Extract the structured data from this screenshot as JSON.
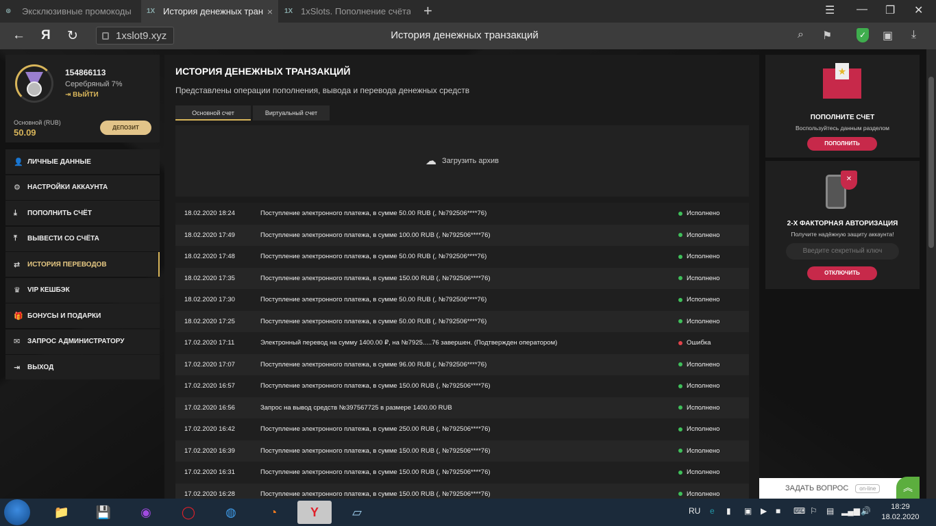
{
  "browser": {
    "tabs": [
      {
        "label": "Эксклюзивные промокоды",
        "icon": "⊛"
      },
      {
        "label": "История денежных тран",
        "icon": "1X",
        "close": "×"
      },
      {
        "label": "1xSlots. Пополнение счёта",
        "icon": "1X"
      }
    ],
    "new_tab": "+",
    "yandex_logo": "Я",
    "url": "1xslot9.xyz",
    "page_title": "История денежных транзакций"
  },
  "profile": {
    "id": "154866113",
    "level": "Серебряный 7%",
    "logout": "ВЫЙТИ",
    "balance_label": "Основной (RUB)",
    "balance": "50.09",
    "deposit": "ДЕПОЗИТ"
  },
  "menu": [
    {
      "label": "ЛИЧНЫЕ ДАННЫЕ",
      "icon": "person-add-icon",
      "glyph": "👤"
    },
    {
      "label": "НАСТРОЙКИ АККАУНТА",
      "icon": "settings-icon",
      "glyph": "⚙"
    },
    {
      "label": "ПОПОЛНИТЬ СЧЁТ",
      "icon": "download-icon",
      "glyph": "⤓"
    },
    {
      "label": "ВЫВЕСТИ СО СЧЁТА",
      "icon": "upload-icon",
      "glyph": "⤒"
    },
    {
      "label": "ИСТОРИЯ ПЕРЕВОДОВ",
      "icon": "transfer-icon",
      "glyph": "⇄",
      "active": true
    },
    {
      "label": "VIP КЕШБЭК",
      "icon": "crown-icon",
      "glyph": "♛"
    },
    {
      "label": "БОНУСЫ И ПОДАРКИ",
      "icon": "gift-icon",
      "glyph": "🎁"
    },
    {
      "label": "ЗАПРОС АДМИНИСТРАТОРУ",
      "icon": "envelope-icon",
      "glyph": "✉"
    },
    {
      "label": "ВЫХОД",
      "icon": "exit-icon",
      "glyph": "⇥"
    }
  ],
  "main": {
    "title": "ИСТОРИЯ ДЕНЕЖНЫХ ТРАНЗАКЦИЙ",
    "description": "Представлены операции пополнения, вывода и перевода денежных средств",
    "tabs": [
      {
        "label": "Основной счет",
        "active": true
      },
      {
        "label": "Виртуальный счет"
      }
    ],
    "archive_label": "Загрузить архив",
    "transactions": [
      {
        "date": "18.02.2020 18:24",
        "message": "Поступление электронного платежа, в сумме 50.00 RUB (, №792506****76)",
        "status": "Исполнено",
        "ok": true
      },
      {
        "date": "18.02.2020 17:49",
        "message": "Поступление электронного платежа, в сумме 100.00 RUB (, №792506****76)",
        "status": "Исполнено",
        "ok": true
      },
      {
        "date": "18.02.2020 17:48",
        "message": "Поступление электронного платежа, в сумме 50.00 RUB (, №792506****76)",
        "status": "Исполнено",
        "ok": true
      },
      {
        "date": "18.02.2020 17:35",
        "message": "Поступление электронного платежа, в сумме 150.00 RUB (, №792506****76)",
        "status": "Исполнено",
        "ok": true
      },
      {
        "date": "18.02.2020 17:30",
        "message": "Поступление электронного платежа, в сумме 50.00 RUB (, №792506****76)",
        "status": "Исполнено",
        "ok": true
      },
      {
        "date": "18.02.2020 17:25",
        "message": "Поступление электронного платежа, в сумме 50.00 RUB (, №792506****76)",
        "status": "Исполнено",
        "ok": true
      },
      {
        "date": "17.02.2020 17:11",
        "message": "Электронный перевод на сумму 1400.00 ₽, на №7925.....76 завершен. (Подтвержден оператором)",
        "status": "Ошибка",
        "ok": false
      },
      {
        "date": "17.02.2020 17:07",
        "message": "Поступление электронного платежа, в сумме 96.00 RUB (, №792506****76)",
        "status": "Исполнено",
        "ok": true
      },
      {
        "date": "17.02.2020 16:57",
        "message": "Поступление электронного платежа, в сумме 150.00 RUB (, №792506****76)",
        "status": "Исполнено",
        "ok": true
      },
      {
        "date": "17.02.2020 16:56",
        "message": "Запрос на вывод средств №397567725 в размере 1400.00 RUB",
        "status": "Исполнено",
        "ok": true
      },
      {
        "date": "17.02.2020 16:42",
        "message": "Поступление электронного платежа, в сумме 250.00 RUB (, №792506****76)",
        "status": "Исполнено",
        "ok": true
      },
      {
        "date": "17.02.2020 16:39",
        "message": "Поступление электронного платежа, в сумме 150.00 RUB (, №792506****76)",
        "status": "Исполнено",
        "ok": true
      },
      {
        "date": "17.02.2020 16:31",
        "message": "Поступление электронного платежа, в сумме 150.00 RUB (, №792506****76)",
        "status": "Исполнено",
        "ok": true
      },
      {
        "date": "17.02.2020 16:28",
        "message": "Поступление электронного платежа, в сумме 150.00 RUB (, №792506****76)",
        "status": "Исполнено",
        "ok": true
      }
    ]
  },
  "right": {
    "deposit": {
      "title": "ПОПОЛНИТЕ СЧЕТ",
      "subtitle": "Воспользуйтесь данным разделом",
      "button": "ПОПОЛНИТЬ"
    },
    "twofa": {
      "title": "2-Х ФАКТОРНАЯ АВТОРИЗАЦИЯ",
      "subtitle": "Получите надёжную защиту аккаунта!",
      "placeholder": "Введите секретный ключ",
      "button": "ОТКЛЮЧИТЬ"
    }
  },
  "chat": {
    "label": "ЗАДАТЬ ВОПРОС",
    "online": "on-line"
  },
  "taskbar": {
    "language": "RU",
    "time": "18:29",
    "date": "18.02.2020"
  },
  "colors": {
    "accent": "#d8b55a",
    "success": "#3fbf5a",
    "error": "#e0434a",
    "pink": "#c7294a"
  }
}
